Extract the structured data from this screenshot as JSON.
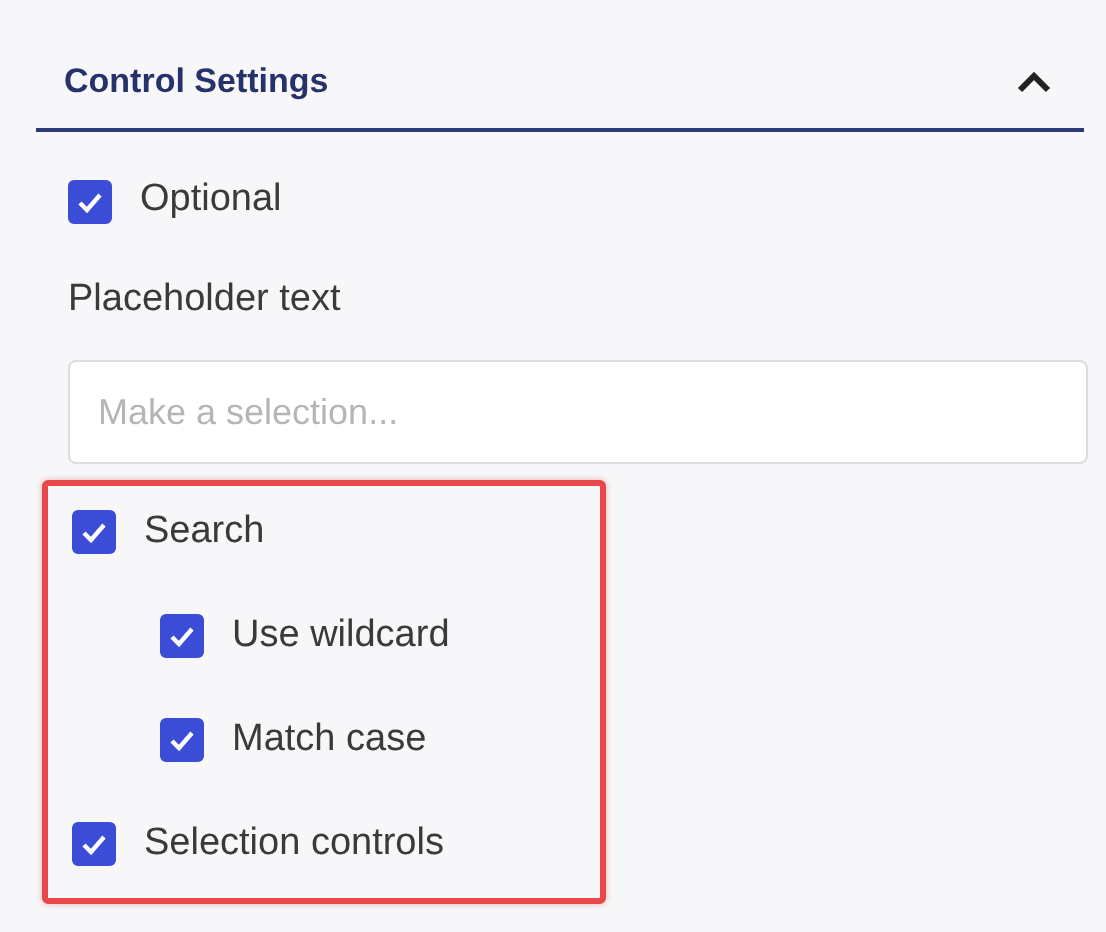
{
  "section": {
    "title": "Control Settings",
    "expanded": true,
    "optional": {
      "label": "Optional",
      "checked": true
    },
    "placeholder_field": {
      "label": "Placeholder text",
      "placeholder": "Make a selection..."
    },
    "highlighted": true,
    "options": [
      {
        "label": "Search",
        "checked": true,
        "children": [
          {
            "label": "Use wildcard",
            "checked": true
          },
          {
            "label": "Match case",
            "checked": true
          }
        ]
      },
      {
        "label": "Selection controls",
        "checked": true
      }
    ]
  }
}
